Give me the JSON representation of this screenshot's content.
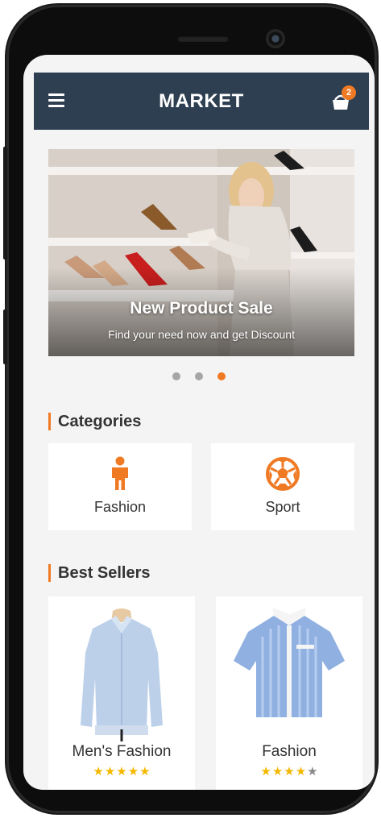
{
  "header": {
    "title": "MARKET",
    "cart_count": "2"
  },
  "banner": {
    "title": "New Product Sale",
    "subtitle": "Find your need now and get Discount",
    "slides": 3,
    "active_slide": 3
  },
  "categories": {
    "heading": "Categories",
    "items": [
      {
        "label": "Fashion",
        "icon": "person-icon"
      },
      {
        "label": "Sport",
        "icon": "soccer-ball-icon"
      }
    ]
  },
  "best_sellers": {
    "heading": "Best Sellers",
    "items": [
      {
        "name": "Men's Fashion",
        "rating": 5,
        "max_rating": 5
      },
      {
        "name": "Fashion",
        "rating": 4,
        "max_rating": 5
      }
    ]
  },
  "colors": {
    "header_bg": "#2e3f52",
    "accent": "#f07a24",
    "star_filled": "#f5b800",
    "star_empty": "#8a8a8a"
  }
}
